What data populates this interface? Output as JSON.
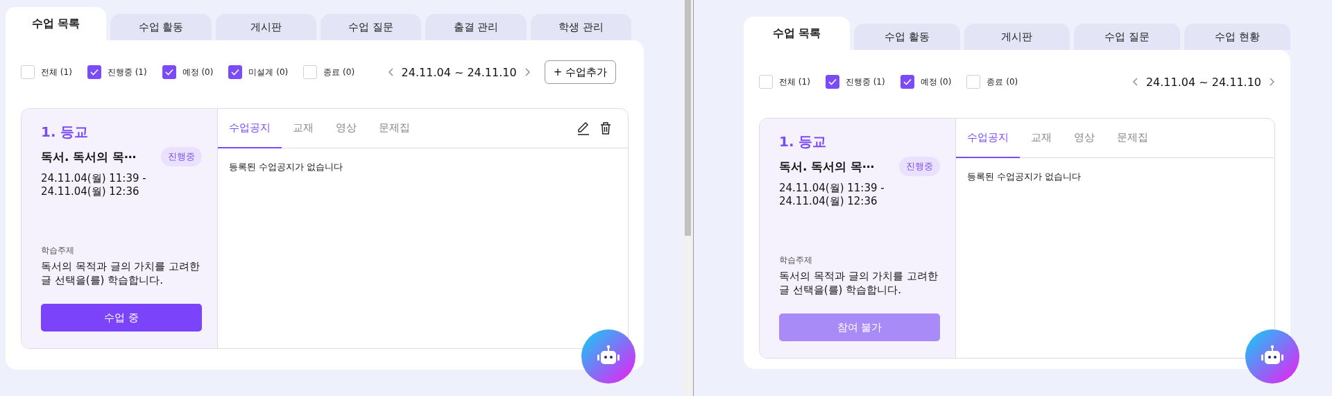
{
  "panes": [
    {
      "tabs": [
        {
          "label": "수업 목록",
          "selected": true
        },
        {
          "label": "수업 활동",
          "selected": false
        },
        {
          "label": "게시판",
          "selected": false
        },
        {
          "label": "수업 질문",
          "selected": false
        },
        {
          "label": "출결 관리",
          "selected": false
        },
        {
          "label": "학생 관리",
          "selected": false
        }
      ],
      "filters": [
        {
          "label": "전체 (1)",
          "checked": false
        },
        {
          "label": "진행중 (1)",
          "checked": true
        },
        {
          "label": "예정 (0)",
          "checked": true
        },
        {
          "label": "미설계 (0)",
          "checked": true
        },
        {
          "label": "종료 (0)",
          "checked": false
        }
      ],
      "date_range": "24.11.04 ~ 24.11.10",
      "add_button": "+ 수업추가",
      "lesson": {
        "number_title": "1. 등교",
        "title": "독서. 독서의 목⋯",
        "status_badge": "진행중",
        "time_start": "24.11.04(월) 11:39 -",
        "time_end": "24.11.04(월) 12:36",
        "topic_label": "학습주제",
        "topic": "독서의 목적과 글의 가치를 고려한 글 선택을(를) 학습합니다.",
        "action_button": {
          "label": "수업 중",
          "disabled": false
        }
      },
      "content_tabs": [
        {
          "label": "수업공지",
          "selected": true
        },
        {
          "label": "교재",
          "selected": false
        },
        {
          "label": "영상",
          "selected": false
        },
        {
          "label": "문제집",
          "selected": false
        }
      ],
      "editable": true,
      "empty_message": "등록된 수업공지가 없습니다"
    },
    {
      "tabs": [
        {
          "label": "수업 목록",
          "selected": true
        },
        {
          "label": "수업 활동",
          "selected": false
        },
        {
          "label": "게시판",
          "selected": false
        },
        {
          "label": "수업 질문",
          "selected": false
        },
        {
          "label": "수업 현황",
          "selected": false
        }
      ],
      "filters": [
        {
          "label": "전체 (1)",
          "checked": false
        },
        {
          "label": "진행중 (1)",
          "checked": true
        },
        {
          "label": "예정 (0)",
          "checked": true
        },
        {
          "label": "종료 (0)",
          "checked": false
        }
      ],
      "date_range": "24.11.04 ~ 24.11.10",
      "lesson": {
        "number_title": "1. 등교",
        "title": "독서. 독서의 목⋯",
        "status_badge": "진행중",
        "time_start": "24.11.04(월) 11:39 -",
        "time_end": "24.11.04(월) 12:36",
        "topic_label": "학습주제",
        "topic": "독서의 목적과 글의 가치를 고려한 글 선택을(를) 학습합니다.",
        "action_button": {
          "label": "참여 불가",
          "disabled": true
        }
      },
      "content_tabs": [
        {
          "label": "수업공지",
          "selected": true
        },
        {
          "label": "교재",
          "selected": false
        },
        {
          "label": "영상",
          "selected": false
        },
        {
          "label": "문제집",
          "selected": false
        }
      ],
      "editable": false,
      "empty_message": "등록된 수업공지가 없습니다"
    }
  ]
}
